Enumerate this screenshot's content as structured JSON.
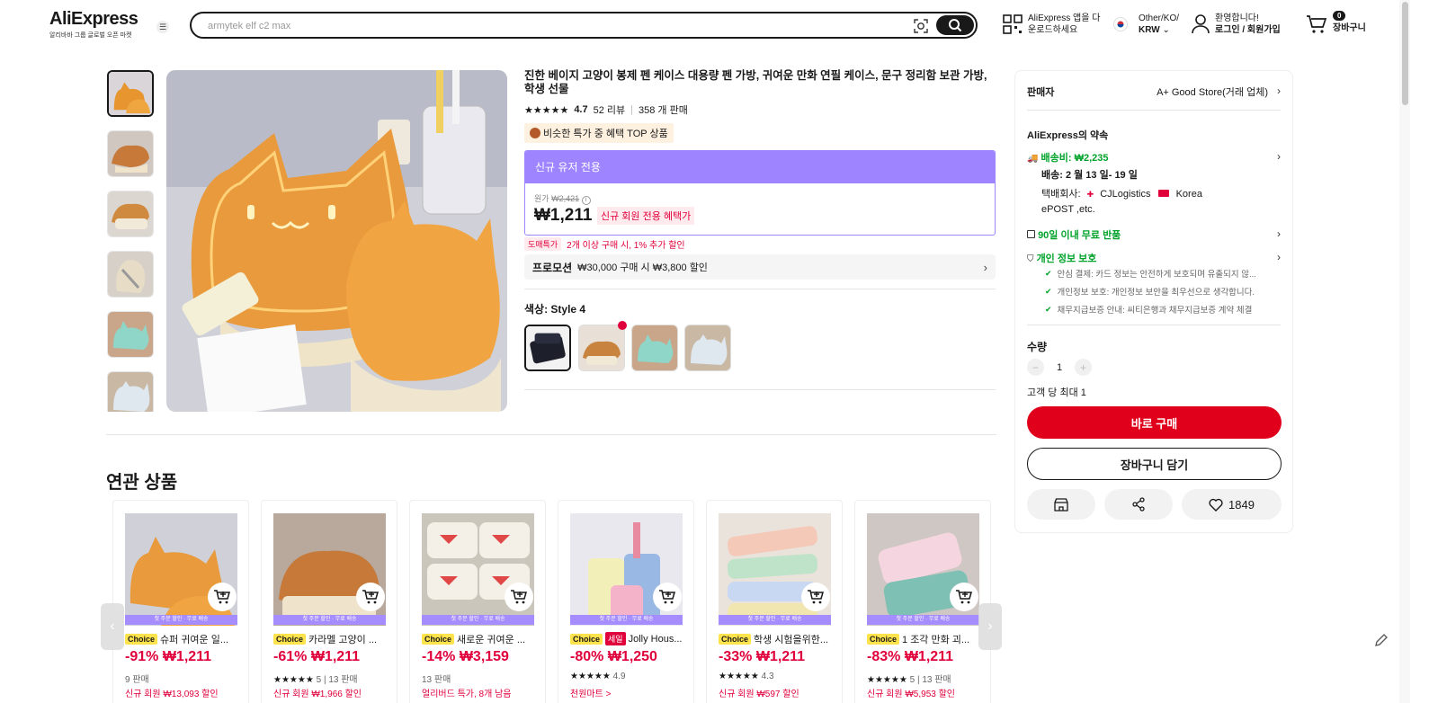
{
  "header": {
    "logo": "AliExpress",
    "logo_tagline": "알리바바 그룹 글로벌 오픈 마켓",
    "search_placeholder": "armytek elf c2 max",
    "app_line1": "AliExpress 앱을 다",
    "app_line2": "운로드하세요",
    "region_line1": "Other/KO/",
    "region_line2": "KRW",
    "account_line1": "환영합니다!",
    "account_line2": "로그인 / 회원가입",
    "cart_count": "0",
    "cart_label": "장바구니"
  },
  "product": {
    "title": "진한 베이지 고양이 봉제 펜 케이스 대용량 펜 가방, 귀여운 만화 연필 케이스, 문구 정리함 보관 가방, 학생 선물",
    "rating": "4.7",
    "reviews": "52 리뷰",
    "sold": "358 개 판매",
    "top_badge": "비슷한 특가 중 혜택 TOP 상품",
    "price_header": "신규 유저 전용",
    "orig_label": "원가",
    "orig_price": "₩2,421",
    "price": "₩1,211",
    "price_tag": "신규 회원 전용 혜택가",
    "deal_pill": "도매특가",
    "deal_text": "2개 이상 구매 시, 1% 추가 할인",
    "promo_label": "프로모션",
    "promo_text": "₩30,000 구매 시 ₩3,800 할인",
    "color_label": "색상: Style 4"
  },
  "panel": {
    "seller_label": "판매자",
    "seller_name": "A+ Good Store(거래 업체)",
    "promise_title": "AliExpress의 약속",
    "shipping_fee": "배송비: ₩2,235",
    "delivery": "배송: 2 월 13 일- 19 일",
    "carrier_label": "택배회사:",
    "carrier1": "CJLogistics",
    "carrier2": "Korea",
    "carrier3": "ePOST ,etc.",
    "returns": "90일 이내 무료 반품",
    "privacy": "개인 정보 보호",
    "privacy_items": [
      "안심 결제: 카드 정보는 안전하게 보호되며 유출되지 않...",
      "개인정보 보호: 개인정보 보안을 최우선으로 생각합니다.",
      "채무지급보증 안내: 씨티은행과 채무지급보증 계약 체결"
    ],
    "qty_label": "수량",
    "qty_value": "1",
    "qty_limit": "고객 당 최대 1",
    "buy_now": "바로 구매",
    "add_cart": "장바구니 담기",
    "wish_count": "1849"
  },
  "related": {
    "title": "연관 상품",
    "strip_text": "첫 주문 할인 · 무료 배송",
    "cards": [
      {
        "badge": "Choice",
        "sale": "",
        "name": "슈퍼 귀여운 일...",
        "pct": "-91%",
        "price": "₩1,211",
        "meta": "9 판매",
        "extra": "신규 회원 ₩13,093 할인"
      },
      {
        "badge": "Choice",
        "sale": "",
        "name": "카라멜 고양이 ...",
        "pct": "-61%",
        "price": "₩1,211",
        "meta": "5 | 13 판매",
        "extra": "신규 회원 ₩1,966 할인"
      },
      {
        "badge": "Choice",
        "sale": "",
        "name": "새로운 귀여운 ...",
        "pct": "-14%",
        "price": "₩3,159",
        "meta": "13 판매",
        "extra": "얼리버드 특가, 8개 남음"
      },
      {
        "badge": "Choice",
        "sale": "세일",
        "name": "Jolly Hous...",
        "pct": "-80%",
        "price": "₩1,250",
        "meta": "4.9",
        "extra": "천원마트 >"
      },
      {
        "badge": "Choice",
        "sale": "",
        "name": "학생 시험을위한...",
        "pct": "-33%",
        "price": "₩1,211",
        "meta": "4.3",
        "extra": "신규 회원 ₩597 할인"
      },
      {
        "badge": "Choice",
        "sale": "",
        "name": "1 조각 만화 괴...",
        "pct": "-83%",
        "price": "₩1,211",
        "meta": "5 | 13 판매",
        "extra": "신규 회원 ₩5,953 할인"
      }
    ]
  }
}
